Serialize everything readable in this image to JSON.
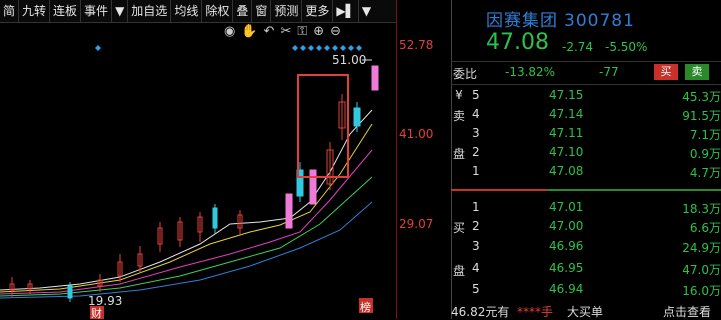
{
  "toolbar": {
    "items": [
      "简",
      "九转",
      "连板",
      "事件",
      "▼",
      "加自选",
      "均线",
      "除权",
      "叠",
      "窗",
      "预测",
      "更多",
      "▶▌",
      "▼"
    ]
  },
  "chart": {
    "axis_labels": [
      "52.78",
      "41.00",
      "29.07"
    ],
    "high_label": "51.00",
    "low_label": "19.93",
    "cai_marker": "财",
    "bang_marker": "榜"
  },
  "quote": {
    "name": "因赛集团",
    "code": "300781",
    "price": "47.08",
    "change": "-2.74",
    "change_pct": "-5.50%",
    "ratio_label": "委比",
    "ratio": "-13.82%",
    "ratio_diff": "-77",
    "buy_btn": "买",
    "sell_btn": "卖"
  },
  "sell_side_label": [
    "¥",
    "卖",
    "",
    "盘",
    ""
  ],
  "asks": [
    {
      "level": "5",
      "price": "47.15",
      "vol": "45.3万"
    },
    {
      "level": "4",
      "price": "47.14",
      "vol": "91.5万"
    },
    {
      "level": "3",
      "price": "47.11",
      "vol": "7.1万"
    },
    {
      "level": "2",
      "price": "47.10",
      "vol": "0.9万"
    },
    {
      "level": "1",
      "price": "47.08",
      "vol": "4.7万"
    }
  ],
  "buy_side_label": [
    "",
    "买",
    "",
    "盘",
    ""
  ],
  "bids": [
    {
      "level": "1",
      "price": "47.01",
      "vol": "18.3万"
    },
    {
      "level": "2",
      "price": "47.00",
      "vol": "6.6万"
    },
    {
      "level": "3",
      "price": "46.96",
      "vol": "24.9万"
    },
    {
      "level": "4",
      "price": "46.95",
      "vol": "47.0万"
    },
    {
      "level": "5",
      "price": "46.94",
      "vol": "16.0万"
    }
  ],
  "footer": {
    "amount": "46.82元有",
    "stars": "****手",
    "big_order": "大买单",
    "view": "点击查看"
  },
  "colors": {
    "up": "#e0403a",
    "down": "#2dc24a",
    "accent": "#2f7fd8"
  }
}
